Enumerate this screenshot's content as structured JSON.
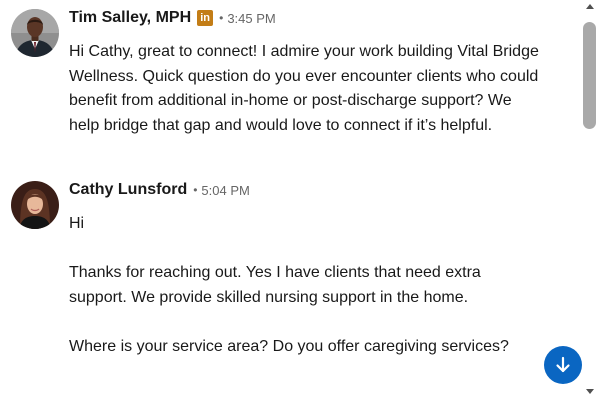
{
  "messages": [
    {
      "sender": "Tim Salley, MPH",
      "badge": "in",
      "separator": "•",
      "time": "3:45 PM",
      "paragraphs": [
        "Hi Cathy, great to connect! I admire your work building Vital Bridge Wellness. Quick question do you ever encounter clients who could benefit from additional in-home or post-discharge support? We help bridge that gap and would love to connect if it’s helpful."
      ]
    },
    {
      "sender": "Cathy Lunsford",
      "separator": "•",
      "time": "5:04 PM",
      "paragraphs": [
        "Hi",
        "Thanks for reaching out. Yes I have clients that need extra support. We provide skilled nursing support in the home.",
        "Where is your service area? Do you offer caregiving services?"
      ]
    }
  ],
  "colors": {
    "accent": "#0a66c2",
    "premium_badge": "#c37d16",
    "scroll_thumb": "#a9a9a9"
  },
  "icons": {
    "jump_to_latest": "arrow-down-icon",
    "scroll_up": "triangle-up-icon",
    "scroll_down": "triangle-down-icon"
  }
}
